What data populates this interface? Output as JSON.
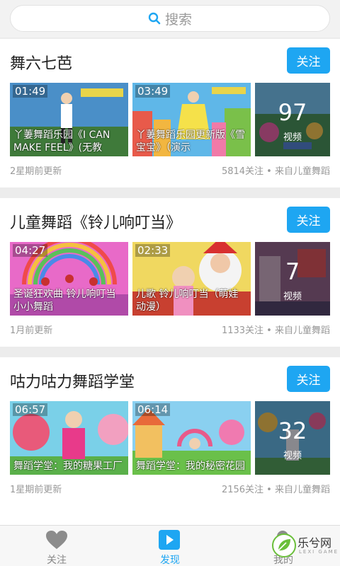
{
  "search": {
    "placeholder": "搜索"
  },
  "colors": {
    "accent": "#1ea6f2"
  },
  "cards": [
    {
      "title": "舞六七芭",
      "follow_label": "关注",
      "videos": [
        {
          "duration": "01:49",
          "caption": "丫萋舞蹈乐园《I CAN MAKE FEEL》(无教"
        },
        {
          "duration": "03:49",
          "caption": "丫萋舞蹈乐园更新版《雪宝宝》（演示"
        }
      ],
      "more": {
        "count": "97",
        "label": "视频"
      },
      "updated": "2星期前更新",
      "stats": "5814关注 • 来自儿童舞蹈"
    },
    {
      "title": "儿童舞蹈《铃儿响叮当》",
      "follow_label": "关注",
      "videos": [
        {
          "duration": "04:27",
          "caption": "圣诞狂欢曲 铃儿响叮当小小舞蹈"
        },
        {
          "duration": "02:33",
          "caption": "儿歌 铃儿响叮当（萌娃动漫）"
        }
      ],
      "more": {
        "count": "7",
        "label": "视频"
      },
      "updated": "1月前更新",
      "stats": "1133关注 • 来自儿童舞蹈"
    },
    {
      "title": "咕力咕力舞蹈学堂",
      "follow_label": "关注",
      "videos": [
        {
          "duration": "06:57",
          "caption": "舞蹈学堂：我的糖果工厂"
        },
        {
          "duration": "06:14",
          "caption": "舞蹈学堂：我的秘密花园"
        }
      ],
      "more": {
        "count": "32",
        "label": "视频"
      },
      "updated": "1星期前更新",
      "stats": "2156关注 • 来自儿童舞蹈"
    }
  ],
  "tabs": [
    {
      "label": "关注",
      "icon": "heart-icon",
      "active": false
    },
    {
      "label": "发现",
      "icon": "play-icon",
      "active": true
    },
    {
      "label": "我的",
      "icon": "user-icon",
      "active": false
    }
  ],
  "watermark": {
    "name": "乐兮网",
    "sub": "LEXI GAME"
  }
}
